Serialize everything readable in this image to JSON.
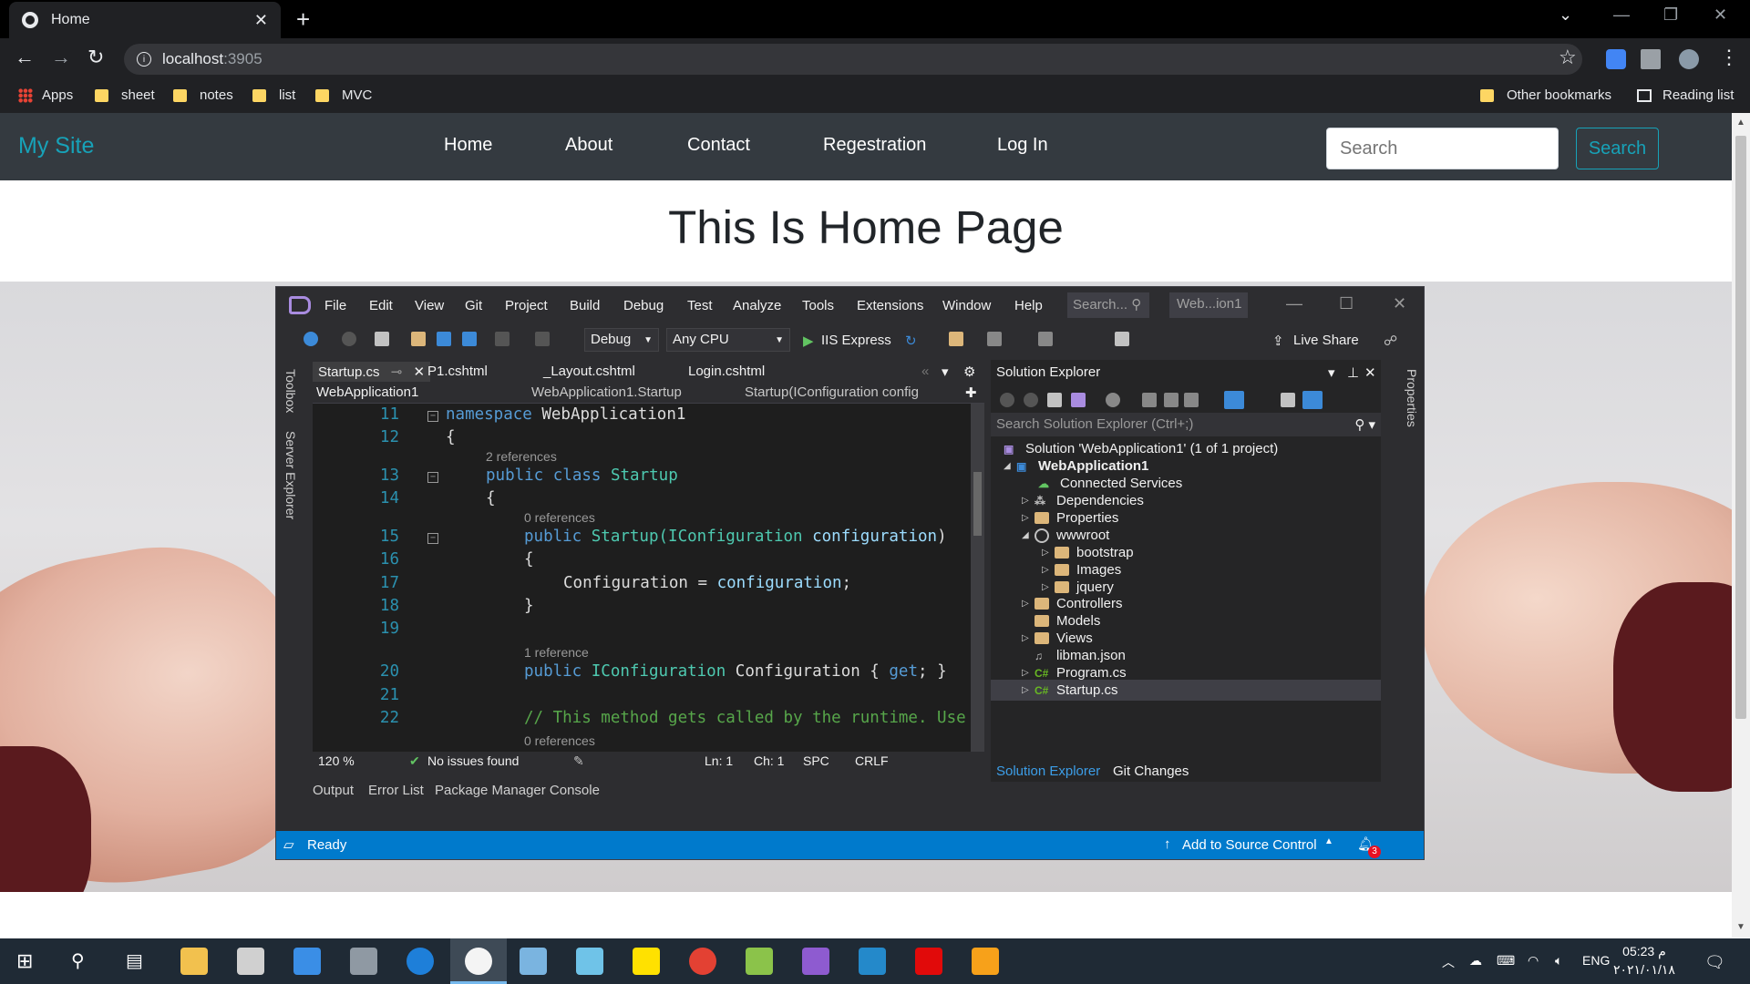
{
  "browser": {
    "tab_title": "Home",
    "url_host": "localhost",
    "url_port": ":3905",
    "bookmarks": [
      "Apps",
      "sheet",
      "notes",
      "list",
      "MVC"
    ],
    "other_bookmarks": "Other bookmarks",
    "reading_list": "Reading list"
  },
  "site": {
    "brand": "My Site",
    "nav": [
      "Home",
      "About",
      "Contact",
      "Regestration",
      "Log In"
    ],
    "search_placeholder": "Search",
    "search_button": "Search",
    "title": "This Is Home Page"
  },
  "vs": {
    "menu": [
      "File",
      "Edit",
      "View",
      "Git",
      "Project",
      "Build",
      "Debug",
      "Test",
      "Analyze",
      "Tools",
      "Extensions",
      "Window",
      "Help"
    ],
    "search": "Search...",
    "solution_name": "Web...ion1",
    "config": "Debug",
    "platform": "Any CPU",
    "run": "IIS Express",
    "live_share": "Live Share",
    "side_toolbox": "Toolbox",
    "side_server": "Server Explorer",
    "side_properties": "Properties",
    "doc_tabs": [
      "Startup.cs",
      "P1.cshtml",
      "_Layout.cshtml",
      "Login.cshtml"
    ],
    "nav_project": "WebApplication1",
    "nav_class": "WebApplication1.Startup",
    "nav_member": "Startup(IConfiguration config",
    "line_numbers": [
      "11",
      "12",
      "13",
      "14",
      "15",
      "16",
      "17",
      "18",
      "19",
      "20",
      "21",
      "22"
    ],
    "refs": {
      "r1": "2 references",
      "r2": "0 references",
      "r3": "1 reference",
      "r4": "0 references"
    },
    "code": {
      "l11_kw": "namespace",
      "l11_name": " WebApplication1",
      "l12": "{",
      "l13_kw": "public class",
      "l13_ty": " Startup",
      "l14": "{",
      "l15_kw": "public",
      "l15_name": " Startup(",
      "l15_ty": "IConfiguration",
      "l15_pa": " configuration",
      "l15_end": ")",
      "l16": "{",
      "l17_a": "Configuration = ",
      "l17_pa": "configuration",
      "l17_end": ";",
      "l18": "}",
      "l20_kw": "public",
      "l20_ty": " IConfiguration",
      "l20_name": " Configuration { ",
      "l20_get": "get",
      "l20_end": "; }",
      "l22": "// This method gets called by the runtime. Use"
    },
    "editor_status": {
      "zoom": "120 %",
      "issues": "No issues found",
      "ln": "Ln: 1",
      "ch": "Ch: 1",
      "spc": "SPC",
      "crlf": "CRLF"
    },
    "bottom_tabs": [
      "Output",
      "Error List",
      "Package Manager Console"
    ],
    "status": "Ready",
    "source_control": "Add to Source Control",
    "notif_count": "3",
    "se": {
      "title": "Solution Explorer",
      "search": "Search Solution Explorer (Ctrl+;)",
      "solution": "Solution 'WebApplication1' (1 of 1 project)",
      "project": "WebApplication1",
      "items": [
        "Connected Services",
        "Dependencies",
        "Properties",
        "wwwroot",
        "bootstrap",
        "Images",
        "jquery",
        "Controllers",
        "Models",
        "Views",
        "libman.json",
        "Program.cs",
        "Startup.cs"
      ],
      "tab_active": "Solution Explorer",
      "tab_git": "Git Changes"
    }
  },
  "taskbar": {
    "lang": "ENG",
    "time": "05:23 م",
    "date": "٢٠٢١/٠١/١٨"
  }
}
